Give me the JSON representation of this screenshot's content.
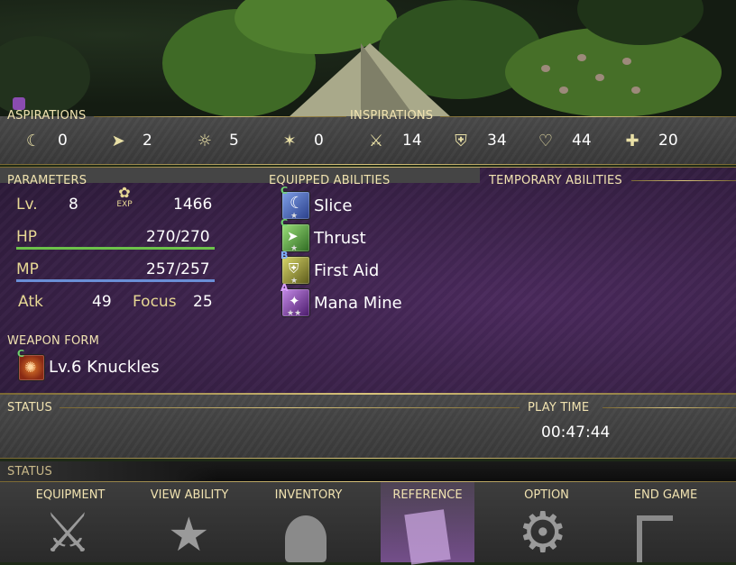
{
  "aspirations": {
    "header": "ASPIRATIONS",
    "items": [
      {
        "icon": "crescent-moon-icon",
        "glyph": "☾",
        "value": "0"
      },
      {
        "icon": "dash-arrow-icon",
        "glyph": "➤",
        "value": "2"
      },
      {
        "icon": "sun-icon",
        "glyph": "☼",
        "value": "5"
      },
      {
        "icon": "spark-burst-icon",
        "glyph": "✶",
        "value": "0"
      }
    ]
  },
  "inspirations": {
    "header": "INSPIRATIONS",
    "items": [
      {
        "icon": "sword-icon",
        "glyph": "⚔",
        "value": "14"
      },
      {
        "icon": "shield-icon",
        "glyph": "⛨",
        "value": "34"
      },
      {
        "icon": "heart-icon",
        "glyph": "♡",
        "value": "44"
      },
      {
        "icon": "heal-plus-icon",
        "glyph": "✚",
        "value": "20"
      }
    ]
  },
  "parameters": {
    "header": "PARAMETERS",
    "lv_label": "Lv.",
    "lv_value": "8",
    "exp_label": "EXP",
    "exp_value": "1466",
    "hp_label": "HP",
    "hp_value": "270/270",
    "hp_ratio": 1.0,
    "mp_label": "MP",
    "mp_value": "257/257",
    "mp_ratio": 1.0,
    "atk_label": "Atk",
    "atk_value": "49",
    "focus_label": "Focus",
    "focus_value": "25"
  },
  "equipped_abilities": {
    "header": "EQUIPPED ABILITIES",
    "items": [
      {
        "name": "Slice",
        "grade": "C",
        "grade_color": "#6fd36f",
        "color": "#3e64b8",
        "stars": "★"
      },
      {
        "name": "Thrust",
        "grade": "C",
        "grade_color": "#6fd36f",
        "color": "#5aa33c",
        "stars": "★"
      },
      {
        "name": "First Aid",
        "grade": "B",
        "grade_color": "#7fb0ff",
        "color": "#a8a83a",
        "stars": "★"
      },
      {
        "name": "Mana Mine",
        "grade": "A",
        "grade_color": "#d9a0ff",
        "color": "#7b3ba8",
        "stars": "★★"
      }
    ]
  },
  "temporary_abilities": {
    "header": "TEMPORARY ABILITIES"
  },
  "weapon_form": {
    "header": "WEAPON FORM",
    "grade": "C",
    "name": "Lv.6 Knuckles"
  },
  "status": {
    "header": "STATUS",
    "play_time_header": "PLAY TIME",
    "play_time": "00:47:44",
    "bar_title": "STATUS"
  },
  "menu": [
    {
      "label": "EQUIPMENT",
      "icon": "crossed-swords-icon",
      "glyph": "⚔"
    },
    {
      "label": "VIEW ABILITY",
      "icon": "star-burst-icon",
      "glyph": "★"
    },
    {
      "label": "INVENTORY",
      "icon": "bag-icon",
      "glyph": "♣"
    },
    {
      "label": "REFERENCE",
      "icon": "book-icon",
      "glyph": "▤",
      "selected": true
    },
    {
      "label": "OPTION",
      "icon": "gear-icon",
      "glyph": "⚙"
    },
    {
      "label": "END GAME",
      "icon": "exit-door-icon",
      "glyph": "⌐"
    }
  ],
  "colors": {
    "gold": "#f0e2b0",
    "hp_bar": "#6cc24a",
    "mp_bar": "#6a8fd6",
    "panel_purple": "#3a2148",
    "selected_menu": "#b06cd9"
  }
}
